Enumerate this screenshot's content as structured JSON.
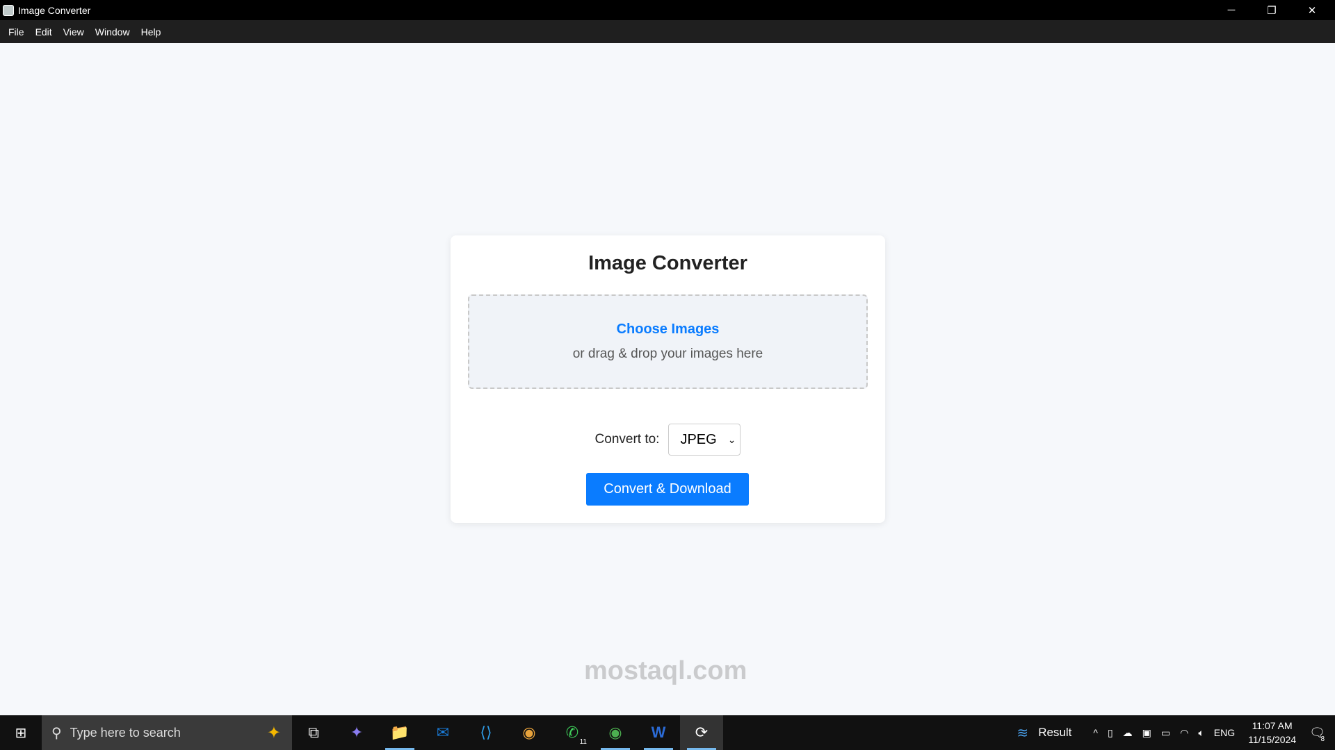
{
  "window": {
    "title": "Image Converter",
    "minimize": "─",
    "maximize": "❐",
    "close": "✕"
  },
  "menu": [
    "File",
    "Edit",
    "View",
    "Window",
    "Help"
  ],
  "card": {
    "title": "Image Converter",
    "choose_label": "Choose Images",
    "drop_hint": "or drag & drop your images here",
    "convert_label": "Convert to:",
    "format_selected": "JPEG",
    "button_label": "Convert & Download"
  },
  "colors": {
    "accent": "#0a7cff"
  },
  "watermark": "mostaql.com",
  "taskbar": {
    "start_icon": "⊞",
    "search_placeholder": "Type here to search",
    "apps": [
      {
        "name": "task-view",
        "glyph": "⧉"
      },
      {
        "name": "copilot",
        "glyph": "✦"
      },
      {
        "name": "file-explorer",
        "glyph": "📁"
      },
      {
        "name": "outlook",
        "glyph": "✉"
      },
      {
        "name": "vscode",
        "glyph": "⟨⟩"
      },
      {
        "name": "chrome",
        "glyph": "◉"
      },
      {
        "name": "whatsapp",
        "glyph": "✆"
      },
      {
        "name": "chrome-profile",
        "glyph": "◉"
      },
      {
        "name": "word",
        "glyph": "W"
      },
      {
        "name": "image-converter",
        "glyph": "⟳"
      }
    ],
    "weather_label": "Result",
    "language": "ENG",
    "time": "11:07 AM",
    "date": "11/15/2024",
    "notification_count": "8",
    "whatsapp_badge": "11"
  }
}
